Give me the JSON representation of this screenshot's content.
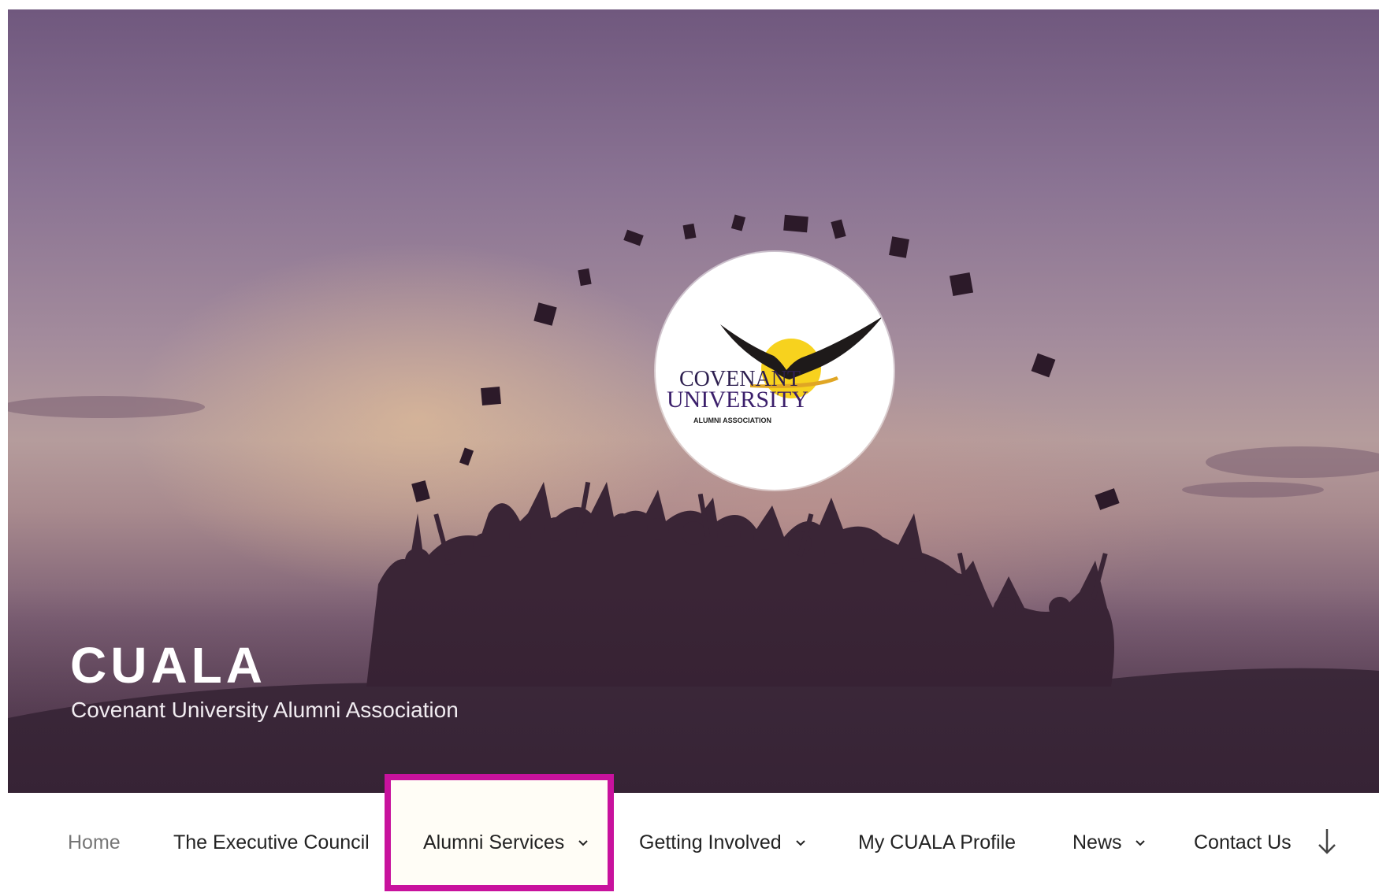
{
  "site": {
    "title": "CUALA",
    "description": "Covenant University Alumni Association"
  },
  "logo": {
    "line1": "COVENANT",
    "line2": "UNIVERSITY",
    "line3": "ALUMNI ASSOCIATION"
  },
  "nav": {
    "items": [
      {
        "label": "Home",
        "has_dropdown": false,
        "current": true
      },
      {
        "label": "The Executive Council",
        "has_dropdown": false
      },
      {
        "label": "Alumni Services",
        "has_dropdown": true,
        "highlighted": true
      },
      {
        "label": "Getting Involved",
        "has_dropdown": true
      },
      {
        "label": "My CUALA Profile",
        "has_dropdown": false
      },
      {
        "label": "News",
        "has_dropdown": true
      },
      {
        "label": "Contact Us",
        "has_dropdown": false
      }
    ],
    "scroll_icon": "arrow-down-icon",
    "caret_icon": "chevron-down-icon"
  },
  "colors": {
    "highlight_border": "#c8129d",
    "nav_text": "#222222",
    "nav_current": "#767676",
    "logo_purple": "#3b1f6b",
    "logo_sun": "#f7d21e"
  }
}
